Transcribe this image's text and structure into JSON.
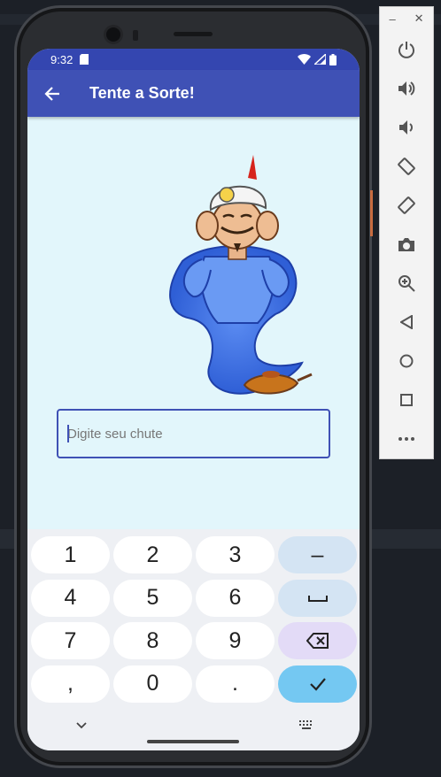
{
  "status_bar": {
    "time": "9:32"
  },
  "app_bar": {
    "title": "Tente a Sorte!"
  },
  "guess_input": {
    "placeholder": "Digite seu chute",
    "value": ""
  },
  "keypad": {
    "keys": [
      "1",
      "2",
      "3",
      "–",
      "4",
      "5",
      "6",
      "␣",
      "7",
      "8",
      "9",
      "⌫",
      ",",
      "0",
      ".",
      "✓"
    ]
  },
  "colors": {
    "app_bar": "#3f51b5",
    "status_bar": "#3446b0",
    "screen_background": "#e2f6fb",
    "accent_key": "#74c8f2",
    "delete_key": "#e3dbf7",
    "function_key": "#d4e4f3"
  },
  "emulator_toolbar": {
    "buttons": [
      "minimize-icon",
      "close-icon",
      "power-icon",
      "volume-up-icon",
      "volume-down-icon",
      "rotate-left-icon",
      "rotate-right-icon",
      "camera-icon",
      "zoom-icon",
      "back-icon",
      "home-icon",
      "overview-icon",
      "more-icon"
    ]
  }
}
